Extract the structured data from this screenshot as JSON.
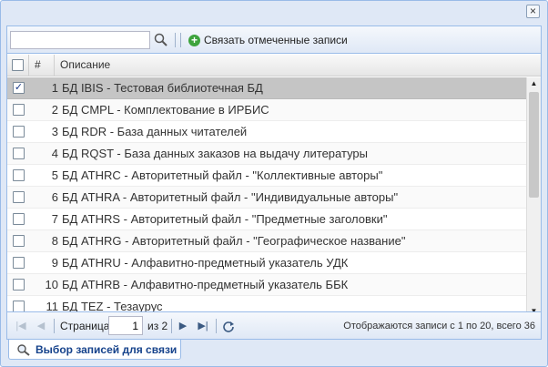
{
  "window": {
    "close_glyph": "×"
  },
  "toolbar": {
    "search": {
      "value": "",
      "placeholder": ""
    },
    "link_button_label": "Связать отмеченные записи"
  },
  "grid": {
    "columns": {
      "number": "#",
      "description": "Описание"
    },
    "rows": [
      {
        "n": "1",
        "desc": "БД IBIS - Тестовая библиотечная БД",
        "checked": true,
        "selected": true
      },
      {
        "n": "2",
        "desc": "БД CMPL - Комплектование в ИРБИС",
        "checked": false,
        "selected": false
      },
      {
        "n": "3",
        "desc": "БД RDR - База данных читателей",
        "checked": false,
        "selected": false
      },
      {
        "n": "4",
        "desc": "БД RQST - База данных заказов на выдачу литературы",
        "checked": false,
        "selected": false
      },
      {
        "n": "5",
        "desc": "БД ATHRC - Авторитетный файл - \"Коллективные авторы\"",
        "checked": false,
        "selected": false
      },
      {
        "n": "6",
        "desc": "БД ATHRA - Авторитетный файл - \"Индивидуальные авторы\"",
        "checked": false,
        "selected": false
      },
      {
        "n": "7",
        "desc": "БД ATHRS - Авторитетный файл - \"Предметные заголовки\"",
        "checked": false,
        "selected": false
      },
      {
        "n": "8",
        "desc": "БД ATHRG - Авторитетный файл - \"Географическое название\"",
        "checked": false,
        "selected": false
      },
      {
        "n": "9",
        "desc": "БД ATHRU - Алфавитно-предметный указатель УДК",
        "checked": false,
        "selected": false
      },
      {
        "n": "10",
        "desc": "БД ATHRB - Алфавитно-предметный указатель ББК",
        "checked": false,
        "selected": false
      },
      {
        "n": "11",
        "desc": "БД TEZ - Тезаурус",
        "checked": false,
        "selected": false
      }
    ]
  },
  "pager": {
    "page_label": "Страница",
    "page_value": "1",
    "of_label": "из 2",
    "display_info": "Отображаются записи с 1 по 20, всего 36"
  },
  "bottom_tab": {
    "label": "Выбор записей для связи"
  },
  "colors": {
    "accent": "#99bbe8",
    "selected_row": "#c5c5c5",
    "add_icon": "#3da33d"
  }
}
